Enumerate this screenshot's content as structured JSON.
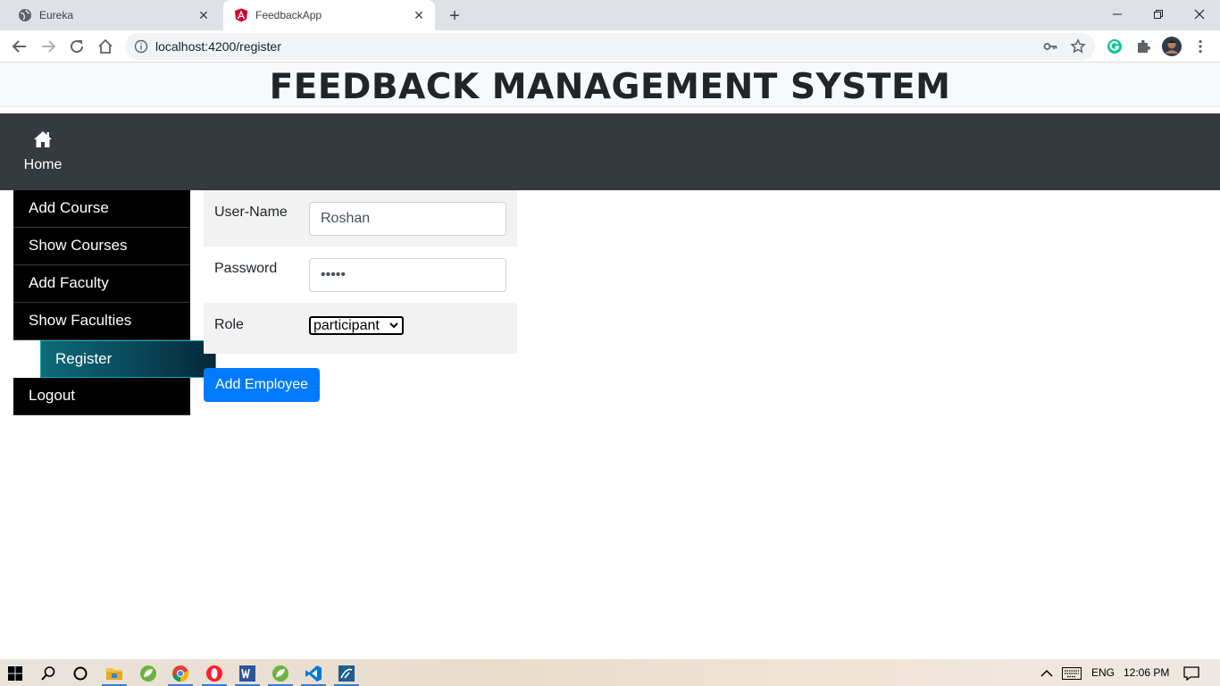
{
  "browser": {
    "tabs": [
      {
        "title": "Eureka",
        "active": false
      },
      {
        "title": "FeedbackApp",
        "active": true
      }
    ],
    "url": "localhost:4200/register"
  },
  "app": {
    "title": "FEEDBACK MANAGEMENT SYSTEM",
    "navbar": {
      "home_label": "Home"
    },
    "sidebar": {
      "items": [
        {
          "label": "Add Course"
        },
        {
          "label": "Show Courses"
        },
        {
          "label": "Add Faculty"
        },
        {
          "label": "Show Faculties"
        },
        {
          "label": "Register",
          "active": true
        },
        {
          "label": "Logout"
        }
      ]
    },
    "form": {
      "username_label": "User-Name",
      "username_value": "Roshan",
      "password_label": "Password",
      "password_value": "•••••",
      "role_label": "Role",
      "role_selected": "participant",
      "submit_label": "Add Employee"
    }
  },
  "taskbar": {
    "language": "ENG",
    "time": "12:06 PM"
  },
  "colors": {
    "navbar_bg": "#343a40",
    "sidebar_bg": "#000000",
    "active_item_start": "#0c6b78",
    "active_item_end": "#06283a",
    "primary_button": "#007bff"
  }
}
